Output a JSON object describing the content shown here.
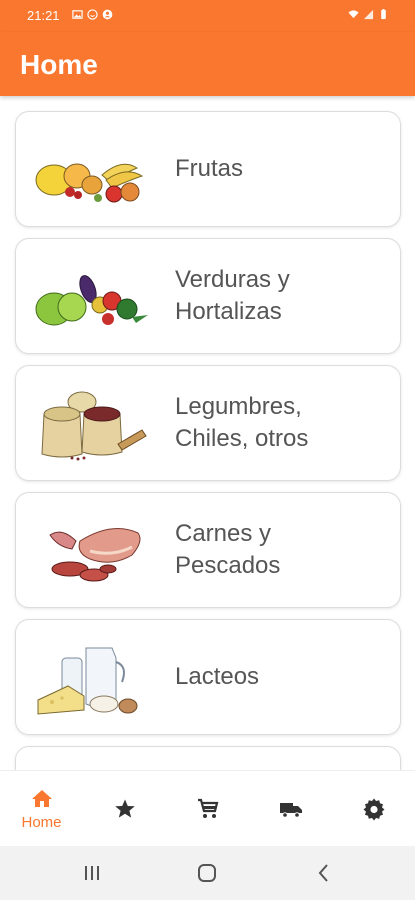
{
  "status_bar": {
    "time": "21:21"
  },
  "app_bar": {
    "title": "Home"
  },
  "categories": [
    {
      "label": "Frutas",
      "image": "fruits-illustration"
    },
    {
      "label": "Verduras y\nHortalizas",
      "image": "vegetables-illustration"
    },
    {
      "label": "Legumbres,\nChiles, otros",
      "image": "legumes-sacks-illustration"
    },
    {
      "label": "Carnes y\nPescados",
      "image": "meats-illustration"
    },
    {
      "label": "Lacteos",
      "image": "dairy-illustration"
    }
  ],
  "bottom_nav": {
    "items": [
      {
        "label": "Home",
        "icon": "home-icon",
        "active": true
      },
      {
        "label": "",
        "icon": "star-icon",
        "active": false
      },
      {
        "label": "",
        "icon": "cart-icon",
        "active": false
      },
      {
        "label": "",
        "icon": "truck-icon",
        "active": false
      },
      {
        "label": "",
        "icon": "gear-icon",
        "active": false
      }
    ]
  },
  "colors": {
    "primary": "#F9772E",
    "text": "#555555",
    "icon": "#333333"
  }
}
